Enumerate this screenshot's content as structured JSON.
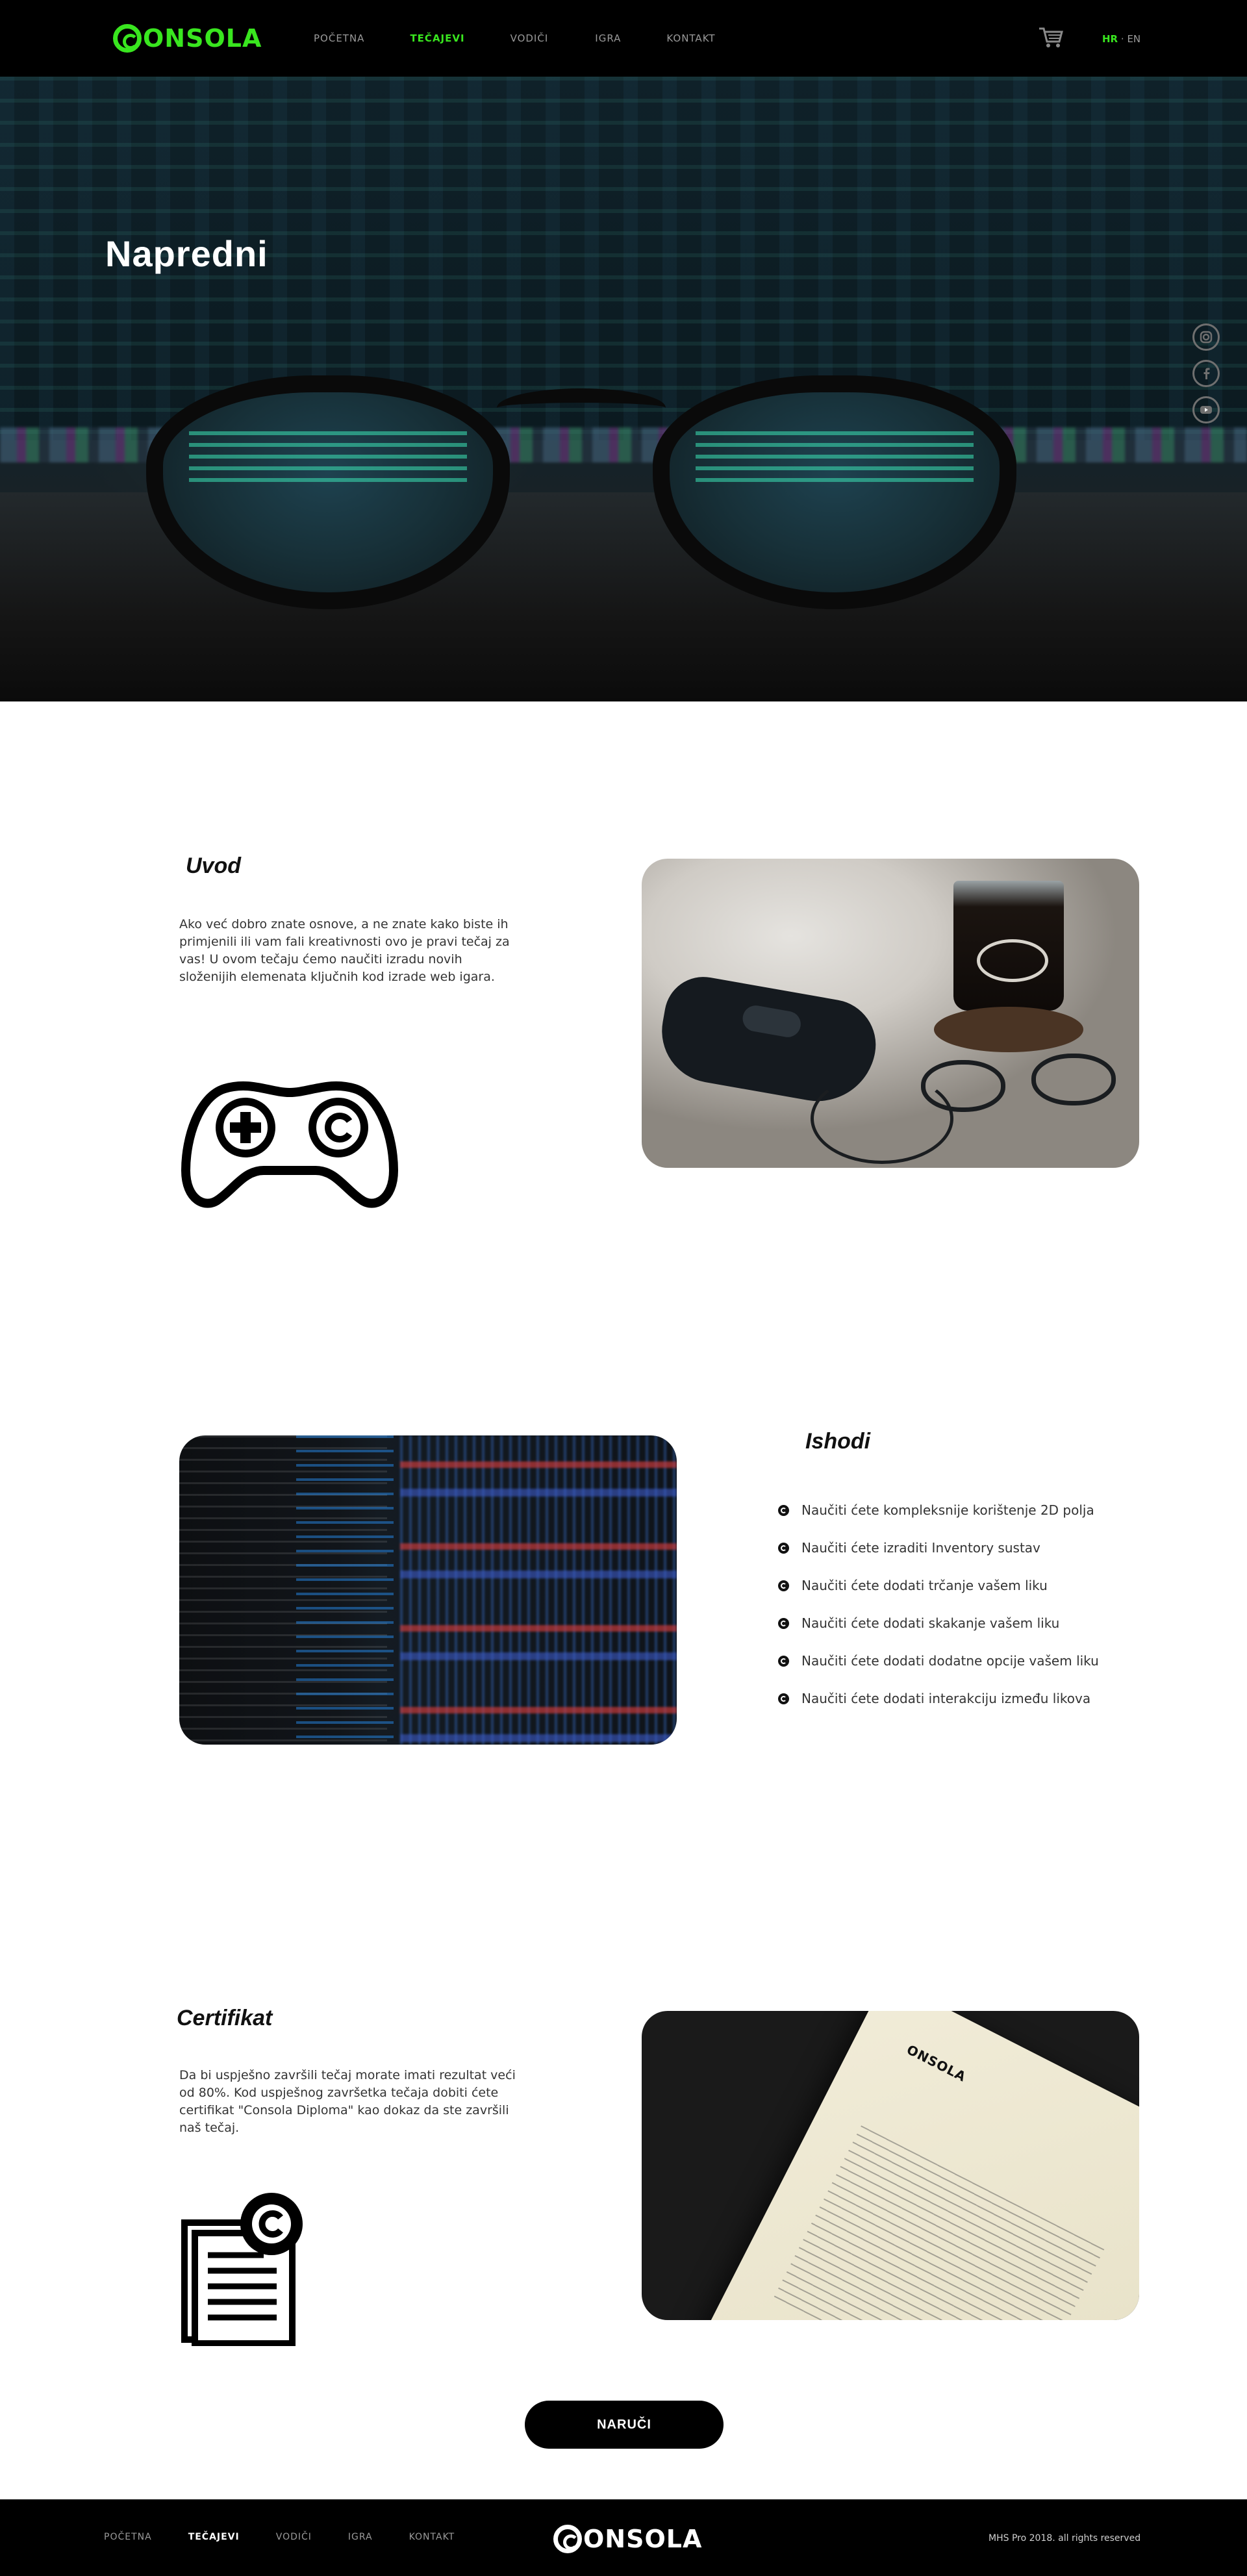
{
  "brand": {
    "logo_text": "ONSOLA",
    "accent": "#39e61f"
  },
  "nav": {
    "links": [
      "POČETNA",
      "TEČAJEVI",
      "VODIČI",
      "IGRA",
      "KONTAKT"
    ],
    "active": "TEČAJEVI",
    "cart_icon": "shopping-cart-icon",
    "lang": {
      "hr": "HR",
      "separator": "·",
      "en": "EN"
    }
  },
  "hero": {
    "title": "Napredni",
    "social_icons": [
      "instagram-icon",
      "facebook-icon",
      "youtube-icon"
    ]
  },
  "uvod": {
    "heading": "Uvod",
    "text": "Ako već dobro znate osnove, a ne znate kako biste ih primjenili ili vam fali kreativnosti ovo je pravi tečaj za vas! U ovom tečaju ćemo naučiti izradu novih složenijih elemenata ključnih kod izrade web igara.",
    "icon": "gamepad-icon"
  },
  "ishodi": {
    "heading": "Ishodi",
    "items": [
      "Naučiti ćete kompleksnije korištenje 2D polja",
      "Naučiti ćete izraditi Inventory sustav",
      "Naučiti ćete dodati trčanje vašem liku",
      "Naučiti ćete dodati skakanje vašem liku",
      "Naučiti ćete dodati dodatne opcije vašem liku",
      "Naučiti ćete dodati interakciju između likova"
    ]
  },
  "certifikat": {
    "heading": "Certifikat",
    "text": "Da bi uspješno završili tečaj morate imati rezultat veći od 80%. Kod uspješnog završetka tečaja dobiti ćete certifikat \"Consola Diploma\" kao dokaz da ste završili naš tečaj.",
    "icon": "certificate-document-icon"
  },
  "cta": {
    "label": "NARUČI"
  },
  "footer": {
    "links": [
      "POČETNA",
      "TEČAJEVI",
      "VODIČI",
      "IGRA",
      "KONTAKT"
    ],
    "active": "TEČAJEVI",
    "copyright": "MHS Pro 2018. all rights reserved"
  }
}
